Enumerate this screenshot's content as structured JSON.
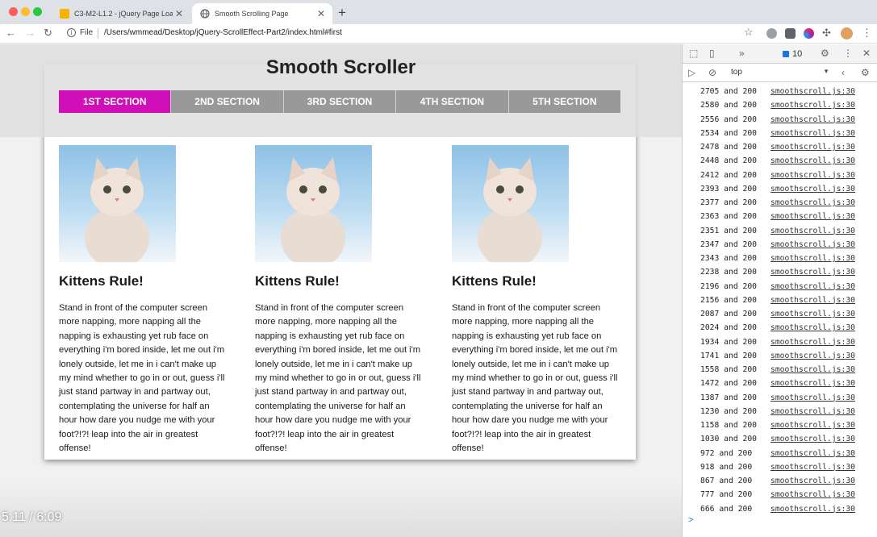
{
  "browser": {
    "tabs": [
      {
        "title": "C3-M2-L1.2 - jQuery Page Loa",
        "active": false,
        "icon": "slides-icon"
      },
      {
        "title": "Smooth Scrolling Page",
        "active": true,
        "icon": "globe-icon"
      }
    ],
    "file_label": "File",
    "url": "/Users/wmmead/Desktop/jQuery-ScrollEffect-Part2/index.html#first"
  },
  "page": {
    "title": "Smooth Scroller",
    "nav": [
      "1ST SECTION",
      "2ND SECTION",
      "3RD SECTION",
      "4TH SECTION",
      "5TH SECTION"
    ],
    "active_nav": 0,
    "accent_color": "#d10fb8",
    "columns": [
      {
        "heading": "Kittens Rule!",
        "body": "Stand in front of the computer screen more napping, more napping all the napping is exhausting yet rub face on everything i'm bored inside, let me out i'm lonely outside, let me in i can't make up my mind whether to go in or out, guess i'll just stand partway in and partway out, contemplating the universe for half an hour how dare you nudge me with your foot?!?! leap into the air in greatest offense!"
      },
      {
        "heading": "Kittens Rule!",
        "body": "Stand in front of the computer screen more napping, more napping all the napping is exhausting yet rub face on everything i'm bored inside, let me out i'm lonely outside, let me in i can't make up my mind whether to go in or out, guess i'll just stand partway in and partway out, contemplating the universe for half an hour how dare you nudge me with your foot?!?! leap into the air in greatest offense!"
      },
      {
        "heading": "Kittens Rule!",
        "body": "Stand in front of the computer screen more napping, more napping all the napping is exhausting yet rub face on everything i'm bored inside, let me out i'm lonely outside, let me in i can't make up my mind whether to go in or out, guess i'll just stand partway in and partway out, contemplating the universe for half an hour how dare you nudge me with your foot?!?! leap into the air in greatest offense!"
      }
    ]
  },
  "video": {
    "time": "5:11  /  6:09"
  },
  "devtools": {
    "message_count": "10",
    "context": "top",
    "console": [
      {
        "msg": "2705 and 200",
        "src": "smoothscroll.js:30"
      },
      {
        "msg": "2580 and 200",
        "src": "smoothscroll.js:30"
      },
      {
        "msg": "2556 and 200",
        "src": "smoothscroll.js:30"
      },
      {
        "msg": "2534 and 200",
        "src": "smoothscroll.js:30"
      },
      {
        "msg": "2478 and 200",
        "src": "smoothscroll.js:30"
      },
      {
        "msg": "2448 and 200",
        "src": "smoothscroll.js:30"
      },
      {
        "msg": "2412 and 200",
        "src": "smoothscroll.js:30"
      },
      {
        "msg": "2393 and 200",
        "src": "smoothscroll.js:30"
      },
      {
        "msg": "2377 and 200",
        "src": "smoothscroll.js:30"
      },
      {
        "msg": "2363 and 200",
        "src": "smoothscroll.js:30"
      },
      {
        "msg": "2351 and 200",
        "src": "smoothscroll.js:30"
      },
      {
        "msg": "2347 and 200",
        "src": "smoothscroll.js:30"
      },
      {
        "msg": "2343 and 200",
        "src": "smoothscroll.js:30"
      },
      {
        "msg": "2238 and 200",
        "src": "smoothscroll.js:30"
      },
      {
        "msg": "2196 and 200",
        "src": "smoothscroll.js:30"
      },
      {
        "msg": "2156 and 200",
        "src": "smoothscroll.js:30"
      },
      {
        "msg": "2087 and 200",
        "src": "smoothscroll.js:30"
      },
      {
        "msg": "2024 and 200",
        "src": "smoothscroll.js:30"
      },
      {
        "msg": "1934 and 200",
        "src": "smoothscroll.js:30"
      },
      {
        "msg": "1741 and 200",
        "src": "smoothscroll.js:30"
      },
      {
        "msg": "1558 and 200",
        "src": "smoothscroll.js:30"
      },
      {
        "msg": "1472 and 200",
        "src": "smoothscroll.js:30"
      },
      {
        "msg": "1387 and 200",
        "src": "smoothscroll.js:30"
      },
      {
        "msg": "1230 and 200",
        "src": "smoothscroll.js:30"
      },
      {
        "msg": "1158 and 200",
        "src": "smoothscroll.js:30"
      },
      {
        "msg": "1030 and 200",
        "src": "smoothscroll.js:30"
      },
      {
        "msg": "972 and 200",
        "src": "smoothscroll.js:30"
      },
      {
        "msg": "918 and 200",
        "src": "smoothscroll.js:30"
      },
      {
        "msg": "867 and 200",
        "src": "smoothscroll.js:30"
      },
      {
        "msg": "777 and 200",
        "src": "smoothscroll.js:30"
      },
      {
        "msg": "666 and 200",
        "src": "smoothscroll.js:30"
      }
    ],
    "prompt": ">"
  }
}
